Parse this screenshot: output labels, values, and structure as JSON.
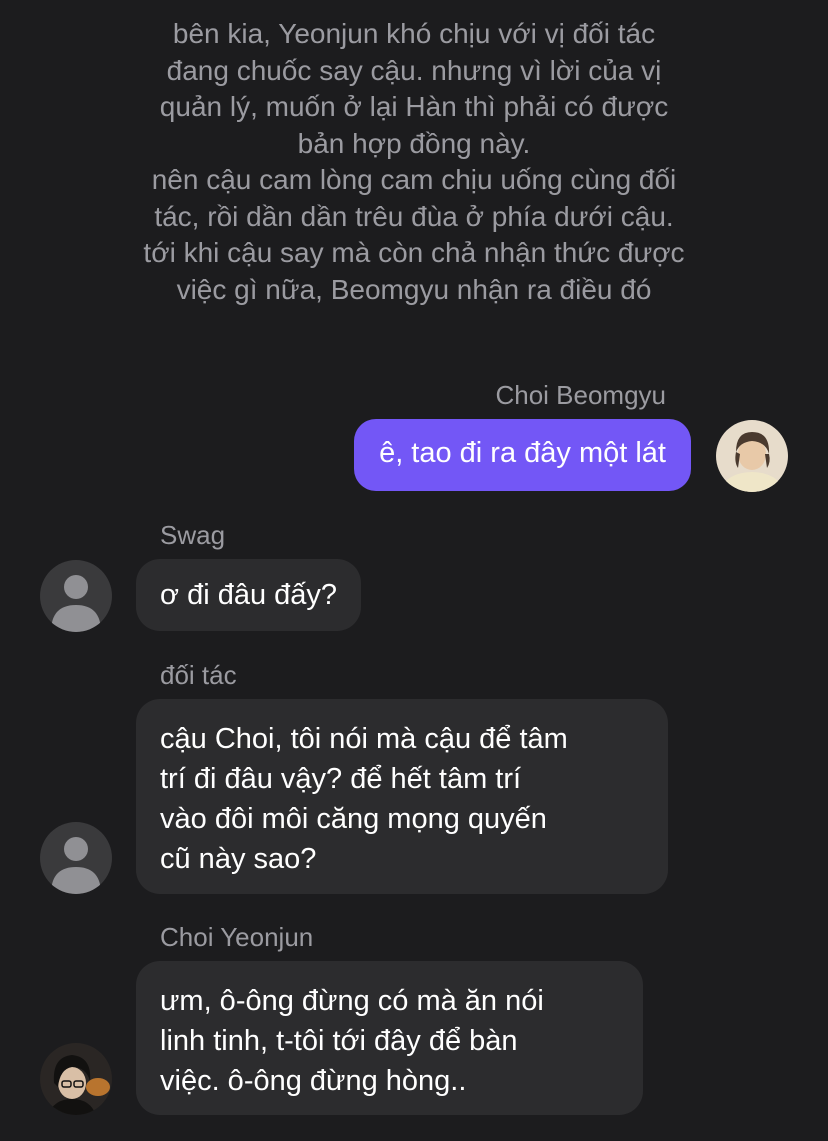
{
  "narration": {
    "lines": [
      "bên kia, Yeonjun khó chịu với vị đối tác",
      "đang chuốc say cậu. nhưng vì lời của vị",
      "quản lý, muốn ở lại Hàn thì phải có được",
      "bản hợp đồng này.",
      "nên cậu cam lòng cam chịu uống cùng đối",
      "tác, rồi dần dần trêu đùa ở phía dưới cậu.",
      "tới khi cậu say mà còn chả nhận thức được",
      "việc gì nữa, Beomgyu nhận ra điều đó"
    ]
  },
  "messages": [
    {
      "sender": "Choi Beomgyu",
      "direction": "outgoing",
      "avatar_icon": "beomgyu-photo-avatar",
      "lines": [
        "ê, tao đi ra đây một lát"
      ]
    },
    {
      "sender": "Swag",
      "direction": "incoming",
      "avatar_icon": "default-person-avatar",
      "lines": [
        "ơ đi đâu đấy?"
      ]
    },
    {
      "sender": "đối tác",
      "direction": "incoming",
      "avatar_icon": "default-person-avatar",
      "lines": [
        "cậu Choi, tôi nói mà cậu để tâm",
        "trí đi đâu vậy? để hết tâm trí",
        "vào đôi môi căng mọng quyến",
        "cũ này sao?"
      ]
    },
    {
      "sender": "Choi Yeonjun",
      "direction": "incoming",
      "avatar_icon": "yeonjun-photo-avatar",
      "lines": [
        "ưm, ô-ông đừng có mà ăn nói",
        "linh tinh, t-tôi tới đây để bàn",
        "việc. ô-ông đừng hòng.."
      ]
    }
  ],
  "colors": {
    "background": "#1c1c1e",
    "incoming_bubble": "#2c2c2e",
    "outgoing_bubble": "#7357f6",
    "secondary_text": "#9b9ba1"
  }
}
